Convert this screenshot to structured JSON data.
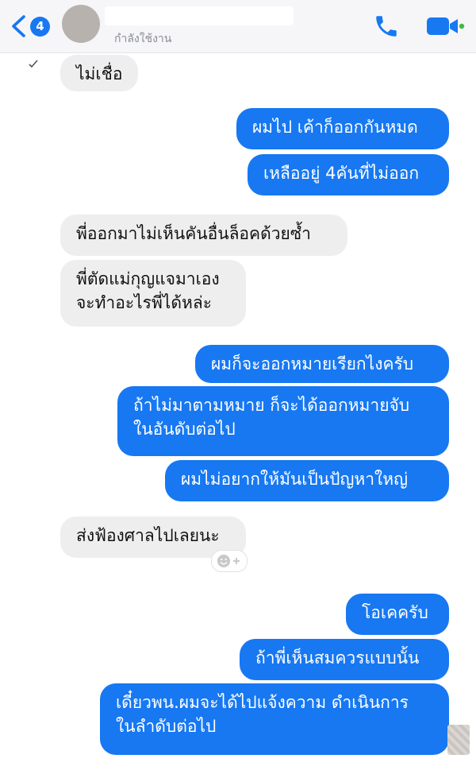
{
  "header": {
    "unread_count": "4",
    "contact_status": "กำลังใช้งาน"
  },
  "messages": [
    {
      "side": "in",
      "text": "ไม่เชื่อ"
    },
    {
      "side": "out",
      "text": "ผมไป เค้าก็ออกกันหมด"
    },
    {
      "side": "out",
      "text": "เหลืออยู่ 4คันที่ไม่ออก"
    },
    {
      "side": "in",
      "text": "พี่ออกมาไม่เห็นคันอื่นล็อคด้วยซ้ำ"
    },
    {
      "side": "in",
      "line1": "พี่ตัดแม่กุญแจมาเอง",
      "line2": "จะทำอะไรพี่ได้หล่ะ"
    },
    {
      "side": "out",
      "text": "ผมก็จะออกหมายเรียกไงครับ"
    },
    {
      "side": "out",
      "line1": "ถ้าไม่มาตามหมาย ก็จะได้ออกหมายจับ",
      "line2": "ในอันดับต่อไป"
    },
    {
      "side": "out",
      "text": "ผมไม่อยากให้มันเป็นปัญหาใหญ่"
    },
    {
      "side": "in",
      "text": "ส่งฟ้องศาลไปเลยนะ"
    },
    {
      "side": "out",
      "text": "โอเคครับ"
    },
    {
      "side": "out",
      "text": "ถ้าพี่เห็นสมควรแบบนั้น"
    },
    {
      "side": "out",
      "line1": "เดี๋ยวพน.ผมจะได้ไปแจ้งความ ดำเนินการ",
      "line2": "ในลำดับต่อไป"
    }
  ],
  "colors": {
    "accent": "#1778f2",
    "incoming_bubble": "#eeeeef",
    "header_bg": "#f6f6f8"
  },
  "icons": [
    "chevron-left-icon",
    "phone-icon",
    "video-camera-icon",
    "emoji-reaction-icon"
  ]
}
